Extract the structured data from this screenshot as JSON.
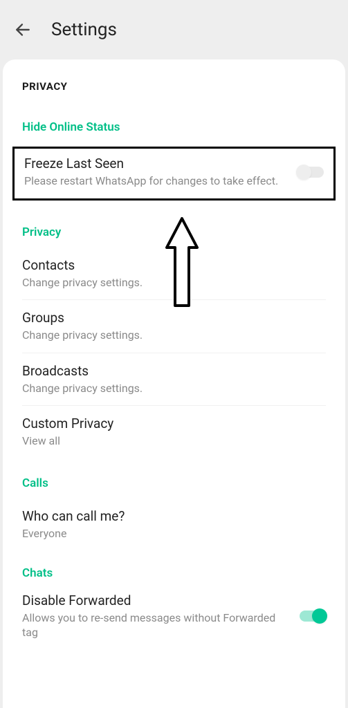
{
  "header": {
    "title": "Settings"
  },
  "page_heading": "PRIVACY",
  "sections": {
    "hide_online": {
      "heading": "Hide Online Status",
      "freeze": {
        "title": "Freeze Last Seen",
        "sub": "Please restart WhatsApp for changes to take effect."
      }
    },
    "privacy": {
      "heading": "Privacy",
      "contacts": {
        "title": "Contacts",
        "sub": "Change privacy settings."
      },
      "groups": {
        "title": "Groups",
        "sub": "Change privacy settings."
      },
      "broadcasts": {
        "title": "Broadcasts",
        "sub": "Change privacy settings."
      },
      "custom": {
        "title": "Custom Privacy",
        "sub": "View all"
      }
    },
    "calls": {
      "heading": "Calls",
      "who": {
        "title": "Who can call me?",
        "sub": "Everyone"
      }
    },
    "chats": {
      "heading": "Chats",
      "disable_fwd": {
        "title": "Disable Forwarded",
        "sub": "Allows you to re-send messages without Forwarded tag"
      }
    }
  },
  "toggles": {
    "freeze_last_seen": false,
    "disable_forwarded": true
  }
}
